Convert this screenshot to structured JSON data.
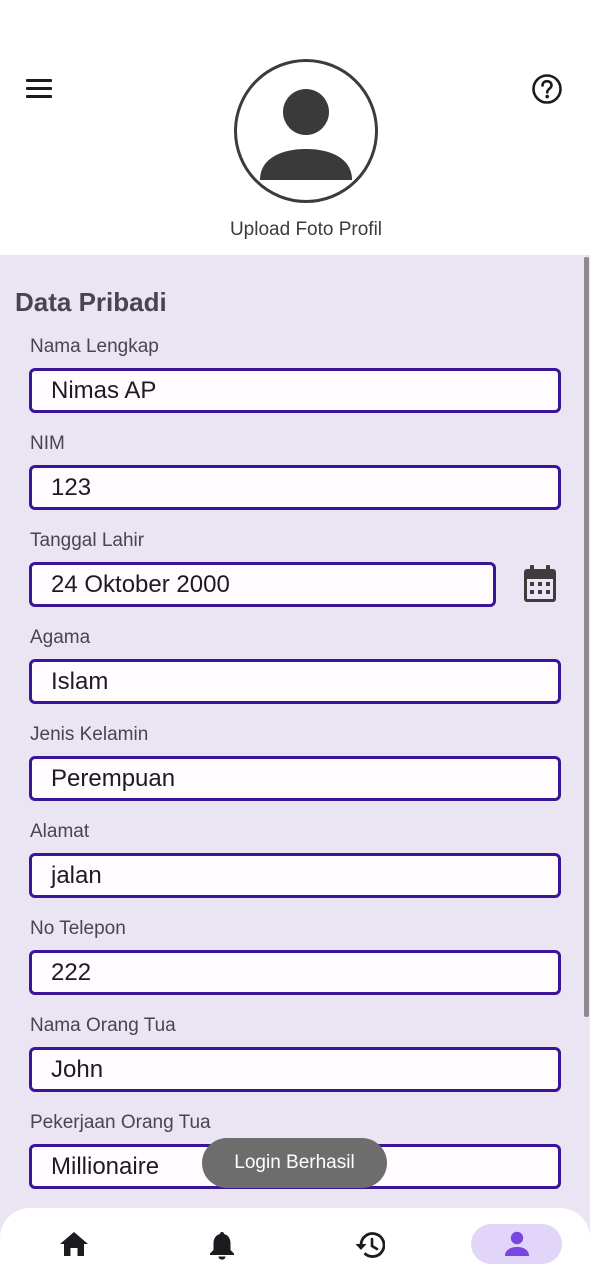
{
  "header": {
    "menu_icon": "hamburger-menu-icon",
    "help_icon": "help-circle-icon",
    "avatar_icon": "person-avatar-icon",
    "upload_label": "Upload Foto Profil"
  },
  "form": {
    "section_title": "Data Pribadi",
    "fields": [
      {
        "label": "Nama Lengkap",
        "value": "Nimas AP"
      },
      {
        "label": "NIM",
        "value": "123"
      },
      {
        "label": "Tanggal Lahir",
        "value": "24 Oktober 2000"
      },
      {
        "label": "Agama",
        "value": "Islam"
      },
      {
        "label": "Jenis Kelamin",
        "value": "Perempuan"
      },
      {
        "label": "Alamat",
        "value": "jalan"
      },
      {
        "label": "No Telepon",
        "value": "222"
      },
      {
        "label": "Nama Orang Tua",
        "value": "John"
      },
      {
        "label": "Pekerjaan Orang Tua",
        "value": "Millionaire"
      }
    ],
    "calendar_icon": "calendar-icon"
  },
  "toast": {
    "text": "Login Berhasil"
  },
  "bottom_nav": {
    "items": [
      {
        "icon": "home-icon",
        "active": false
      },
      {
        "icon": "bell-icon",
        "active": false
      },
      {
        "icon": "history-icon",
        "active": false
      },
      {
        "icon": "person-icon",
        "active": true
      }
    ]
  },
  "colors": {
    "accent": "#3a1597",
    "form_background": "#ebe4f3",
    "active_nav_pill": "#e2d5fa",
    "toast_background": "#6d6d6d"
  }
}
